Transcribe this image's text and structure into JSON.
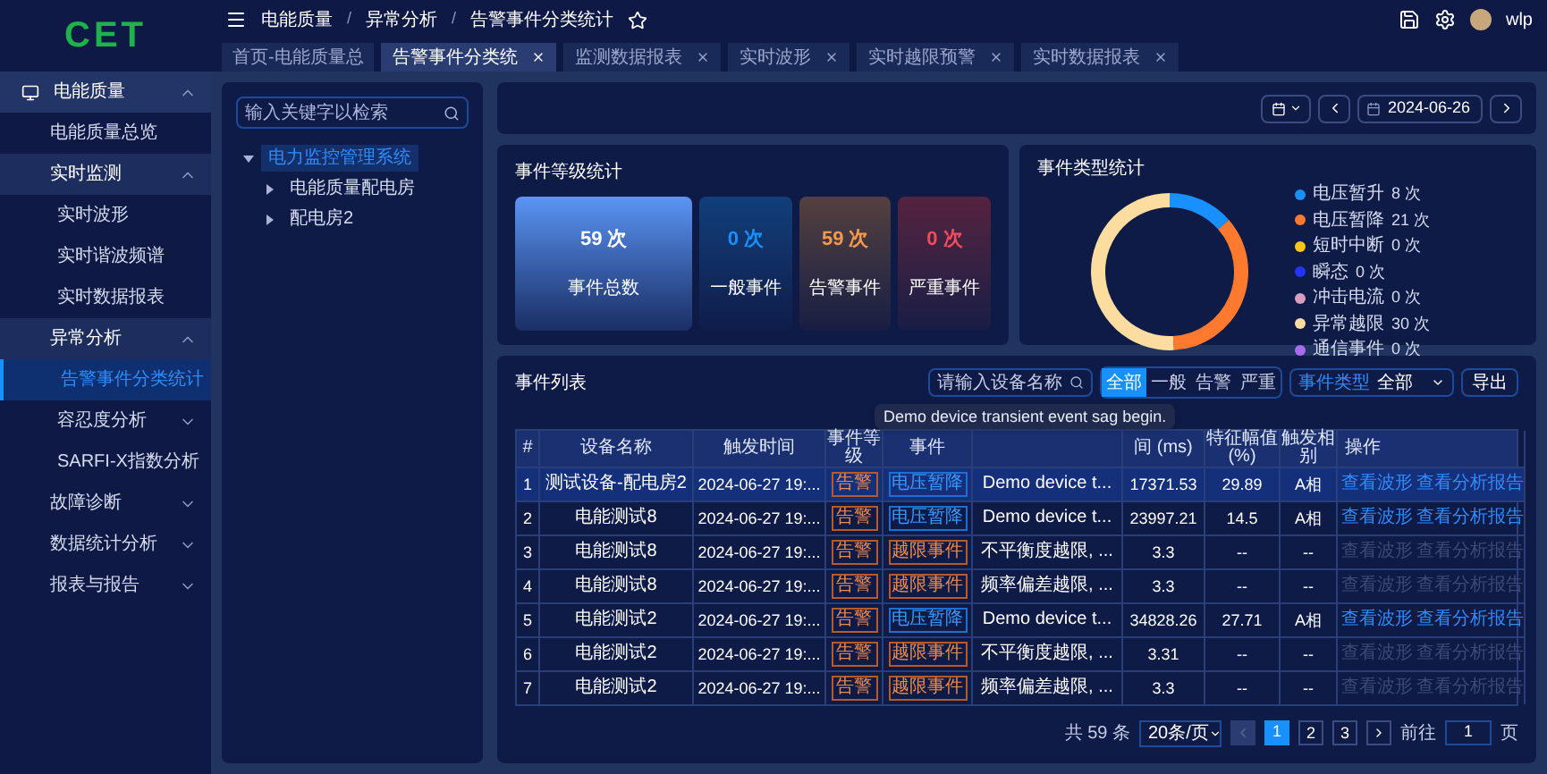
{
  "logo": "CET",
  "sidebar": {
    "items": [
      {
        "label": "电能质量",
        "expanded": true,
        "children": [
          {
            "label": "电能质量总览",
            "selected": false
          },
          {
            "label": "实时监测",
            "expanded": true,
            "children": [
              {
                "label": "实时波形",
                "selected": false
              },
              {
                "label": "实时谐波频谱",
                "selected": false
              },
              {
                "label": "实时数据报表",
                "selected": false
              }
            ]
          },
          {
            "label": "异常分析",
            "expanded": true,
            "children": [
              {
                "label": "告警事件分类统计",
                "selected": true
              },
              {
                "label": "容忍度分析",
                "expanded": false
              },
              {
                "label": "SARFI-X指数分析",
                "selected": false
              }
            ]
          },
          {
            "label": "故障诊断",
            "expanded": false
          },
          {
            "label": "数据统计分析",
            "expanded": false
          },
          {
            "label": "报表与报告",
            "expanded": false
          }
        ]
      }
    ]
  },
  "breadcrumb": {
    "separator": "/",
    "items": [
      "电能质量",
      "异常分析",
      "告警事件分类统计"
    ]
  },
  "user": "wlp",
  "tabs": [
    {
      "label": "首页-电能质量总",
      "selected": false,
      "closable": false
    },
    {
      "label": "告警事件分类统",
      "selected": true,
      "closable": true
    },
    {
      "label": "监测数据报表",
      "selected": false,
      "closable": true
    },
    {
      "label": "实时波形",
      "selected": false,
      "closable": true
    },
    {
      "label": "实时越限预警",
      "selected": false,
      "closable": true
    },
    {
      "label": "实时数据报表",
      "selected": false,
      "closable": true
    }
  ],
  "tree": {
    "search": {
      "placeholder": "输入关键字以检索"
    },
    "nodes": [
      {
        "label": "电力监控管理系统",
        "selected": true,
        "expanded": true,
        "children": [
          {
            "label": "电能质量配电房",
            "selected": false,
            "expanded": false
          },
          {
            "label": "配电房2",
            "selected": false,
            "expanded": false
          }
        ]
      }
    ]
  },
  "date": "2024-06-26",
  "level_stats": {
    "title": "事件等级统计",
    "cards": [
      {
        "kind": "total",
        "value": "59 次",
        "label": "事件总数"
      },
      {
        "kind": "general",
        "value": "0 次",
        "label": "一般事件"
      },
      {
        "kind": "alarm",
        "value": "59 次",
        "label": "告警事件"
      },
      {
        "kind": "severe",
        "value": "0 次",
        "label": "严重事件"
      }
    ]
  },
  "type_stats": {
    "title": "事件类型统计",
    "chart_data": {
      "type": "donut",
      "categories": [
        "电压暂升",
        "电压暂降",
        "短时中断",
        "瞬态",
        "冲击电流",
        "异常越限",
        "通信事件"
      ],
      "values": [
        13.56,
        35.59,
        0,
        0,
        0,
        50.85,
        0
      ]
    },
    "legend": [
      {
        "count": "8 次",
        "color": "#1890ff"
      },
      {
        "count": "21 次",
        "color": "#ff7a2e"
      },
      {
        "count": "0 次",
        "color": "#fcc419"
      },
      {
        "count": "0 次",
        "color": "#2233ff"
      },
      {
        "count": "0 次",
        "color": "#d89cc0"
      },
      {
        "count": "30 次",
        "color": "#fddca0"
      },
      {
        "count": "0 次",
        "color": "#a86cf0"
      }
    ]
  },
  "event_list": {
    "title": "事件列表",
    "search": {
      "placeholder": "请输入设备名称"
    },
    "filters": [
      {
        "label": "全部",
        "selected": true
      },
      {
        "label": "一般",
        "selected": false
      },
      {
        "label": "告警",
        "selected": false
      },
      {
        "label": "严重",
        "selected": false
      }
    ],
    "type_select": {
      "label": "事件类型",
      "value": "全部"
    },
    "export": "导出",
    "columns": [
      "#",
      "设备名称",
      "触发时间",
      "事件等级",
      "事件",
      "",
      "间 (ms)",
      "特征幅值 (%)",
      "触发相别",
      "操作"
    ],
    "tooltip": "Demo device transient event sag begin.",
    "rows": [
      {
        "no": "1",
        "device": "测试设备-配电房2",
        "time": "2024-06-27 19:...",
        "level": "告警",
        "type": "电压暂降",
        "kind": "sag",
        "desc": "Demo device t...",
        "duration": "17371.53",
        "amplitude": "29.89",
        "phase": "A相",
        "actions": [
          "查看波形",
          "查看分析报告"
        ],
        "actions_enabled": true,
        "selected": true
      },
      {
        "no": "2",
        "device": "电能测试8",
        "time": "2024-06-27 19:...",
        "level": "告警",
        "type": "电压暂降",
        "kind": "sag",
        "desc": "Demo device t...",
        "duration": "23997.21",
        "amplitude": "14.5",
        "phase": "A相",
        "actions": [
          "查看波形",
          "查看分析报告"
        ],
        "actions_enabled": true,
        "selected": false
      },
      {
        "no": "3",
        "device": "电能测试8",
        "time": "2024-06-27 19:...",
        "level": "告警",
        "type": "越限事件",
        "kind": "limit",
        "desc": "不平衡度越限, ...",
        "duration": "3.3",
        "amplitude": "--",
        "phase": "--",
        "actions": [
          "查看波形",
          "查看分析报告"
        ],
        "actions_enabled": false,
        "selected": false
      },
      {
        "no": "4",
        "device": "电能测试8",
        "time": "2024-06-27 19:...",
        "level": "告警",
        "type": "越限事件",
        "kind": "limit",
        "desc": "频率偏差越限, ...",
        "duration": "3.3",
        "amplitude": "--",
        "phase": "--",
        "actions": [
          "查看波形",
          "查看分析报告"
        ],
        "actions_enabled": false,
        "selected": false
      },
      {
        "no": "5",
        "device": "电能测试2",
        "time": "2024-06-27 19:...",
        "level": "告警",
        "type": "电压暂降",
        "kind": "sag",
        "desc": "Demo device t...",
        "duration": "34828.26",
        "amplitude": "27.71",
        "phase": "A相",
        "actions": [
          "查看波形",
          "查看分析报告"
        ],
        "actions_enabled": true,
        "selected": false
      },
      {
        "no": "6",
        "device": "电能测试2",
        "time": "2024-06-27 19:...",
        "level": "告警",
        "type": "越限事件",
        "kind": "limit",
        "desc": "不平衡度越限, ...",
        "duration": "3.31",
        "amplitude": "--",
        "phase": "--",
        "actions": [
          "查看波形",
          "查看分析报告"
        ],
        "actions_enabled": false,
        "selected": false
      },
      {
        "no": "7",
        "device": "电能测试2",
        "time": "2024-06-27 19:...",
        "level": "告警",
        "type": "越限事件",
        "kind": "limit",
        "desc": "频率偏差越限, ...",
        "duration": "3.3",
        "amplitude": "--",
        "phase": "--",
        "actions": [
          "查看波形",
          "查看分析报告"
        ],
        "actions_enabled": false,
        "selected": false
      }
    ],
    "pagination": {
      "total": "共 59 条",
      "page_size": "20条/页",
      "pages": [
        {
          "label": "1",
          "selected": true
        },
        {
          "label": "2",
          "selected": false
        },
        {
          "label": "3",
          "selected": false
        }
      ],
      "goto_label": "前往",
      "goto_value": "1",
      "goto_suffix": "页"
    }
  }
}
